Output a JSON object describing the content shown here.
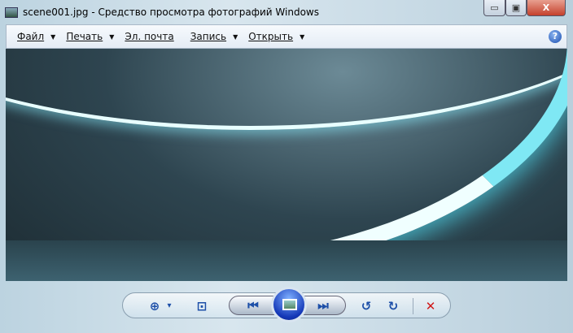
{
  "window": {
    "title": "scene001.jpg - Средство просмотра фотографий Windows",
    "minimize": "▭",
    "maximize": "▣",
    "close": "X"
  },
  "menu": {
    "items": [
      {
        "label": "Файл",
        "dropdown": true
      },
      {
        "label": "Печать",
        "dropdown": true
      },
      {
        "label": "Эл. почта",
        "dropdown": false
      },
      {
        "label": "Запись",
        "dropdown": true
      },
      {
        "label": "Открыть",
        "dropdown": true
      }
    ],
    "help": "?",
    "arrow": "▼"
  },
  "toolbar": {
    "zoom": "⊕",
    "zoom_arrow": "▾",
    "fit": "⊡",
    "prev": "⏮",
    "next": "⏭",
    "rotate_left": "↺",
    "rotate_right": "↻",
    "delete": "✕"
  }
}
